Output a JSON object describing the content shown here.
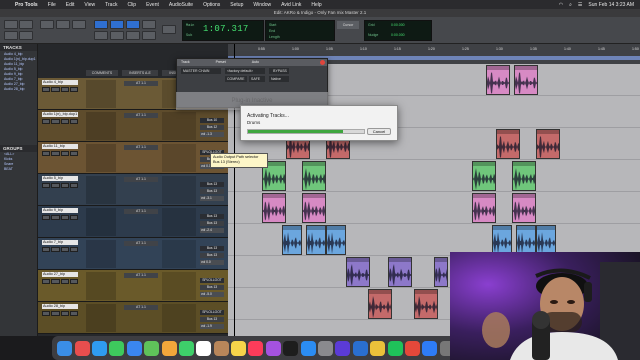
{
  "menubar": {
    "app_name": "Pro Tools",
    "items": [
      "File",
      "Edit",
      "View",
      "Track",
      "Clip",
      "Event",
      "AudioSuite",
      "Options",
      "Setup",
      "Window",
      "Avid Link",
      "Help"
    ],
    "datetime": "Sun Feb 14 3:23 AM"
  },
  "titlebar": {
    "title": "Edit: AKRo & Indigo - Only Fan mix Master 2.1"
  },
  "toolbar": {
    "counter_main": "1:07.317",
    "counter_labels": [
      "Main",
      "Sub"
    ],
    "start_label": "Start",
    "end_label": "End",
    "length_label": "Length",
    "cursor_label": "Cursor",
    "nudge_label": "Nudge",
    "grid_label": "Grid",
    "nudge_value": "0:00.000",
    "grid_value": "0:00.000"
  },
  "left_panel": {
    "tracks_header": "TRACKS",
    "groups_header": "GROUPS",
    "groups": [
      "<ALL>",
      "Kicks",
      "Snare",
      "BEAT"
    ]
  },
  "mixer": {
    "headers": [
      "COMMENTS",
      "INSERTS A-E",
      "INSERTS F-J",
      "I/O"
    ],
    "tracks": [
      {
        "name": "Audio 4_bip",
        "color": "#6b5a36",
        "insert": "AT 1.1",
        "io_in": "Bus 10",
        "io_out": "Bus 12",
        "vol": "vol -4.2"
      },
      {
        "name": "Audio 1(n)_bip.dup1",
        "color": "#5e4c2c",
        "insert": "AT 1.1",
        "io_in": "Bus 10",
        "io_out": "Bus 12",
        "vol": "vol -1.3"
      },
      {
        "name": "Audio 11_bip",
        "color": "#6c5433",
        "insert": "AT 1.1",
        "io_in": "SPLOLLOOT",
        "io_out": "Bus 13",
        "vol": "vol 0.0"
      },
      {
        "name": "Audio 5_bip",
        "color": "#33404f",
        "insert": "AT 1.1",
        "io_in": "Bus 13",
        "io_out": "Bus 13",
        "vol": "vol -3.1"
      },
      {
        "name": "Audio 9_bip",
        "color": "#2d3b4c",
        "insert": "AT 1.1",
        "io_in": "Bus 13",
        "io_out": "Bus 13",
        "vol": "vol -2.4"
      },
      {
        "name": "Audio 7_bip",
        "color": "#324357",
        "insert": "AT 1.1",
        "io_in": "Bus 13",
        "io_out": "Bus 13",
        "vol": "vol 0.0"
      },
      {
        "name": "Audio 27_bip",
        "color": "#6a5a2a",
        "insert": "AT 1.1",
        "io_in": "SPLOLLOOT",
        "io_out": "Bus 13",
        "vol": "vol -5.0"
      },
      {
        "name": "Audio 28_bip",
        "color": "#5c4e26",
        "insert": "AT 1.1",
        "io_in": "SPLOLLOOT",
        "io_out": "Bus 13",
        "vol": "vol -1.9"
      }
    ]
  },
  "plugin_window": {
    "col_track": "Track",
    "col_preset": "Preset",
    "col_auto": "Auto",
    "track_value": "MASTER CHAIN",
    "preset_value": "<factory default>",
    "compare": "COMPARE",
    "safe": "SAFE",
    "bypass": "BYPASS",
    "native": "Native",
    "plugin_inactive": "Plug-in Inactive"
  },
  "activating_dialog": {
    "title": "Activating Tracks...",
    "subtitle": "Drums",
    "progress": 0.82,
    "cancel_label": "Cancel"
  },
  "tooltip": {
    "line1": "Audio Output Path selector",
    "line2": "Bus 13 (Stereo)"
  },
  "ruler": {
    "labels": [
      "0:55",
      "1:00",
      "1:05",
      "1:10",
      "1:15",
      "1:20",
      "1:25",
      "1:30",
      "1:35",
      "1:40",
      "1:45",
      "1:50"
    ]
  },
  "dock": {
    "apps": [
      "finder",
      "launchpad",
      "safari",
      "messages",
      "mail",
      "maps",
      "photos",
      "facetime",
      "calendar",
      "contacts",
      "notes",
      "music",
      "podcasts",
      "tv",
      "app-store",
      "settings",
      "pro-tools",
      "waves",
      "izotope",
      "spotify",
      "chrome",
      "zoom",
      "trash"
    ]
  },
  "colors": {
    "clip_red": "#c46a6a",
    "clip_green": "#6fc67b",
    "clip_pink": "#d78ac4",
    "clip_blue": "#6ba6de",
    "clip_purple": "#8d78c9"
  }
}
